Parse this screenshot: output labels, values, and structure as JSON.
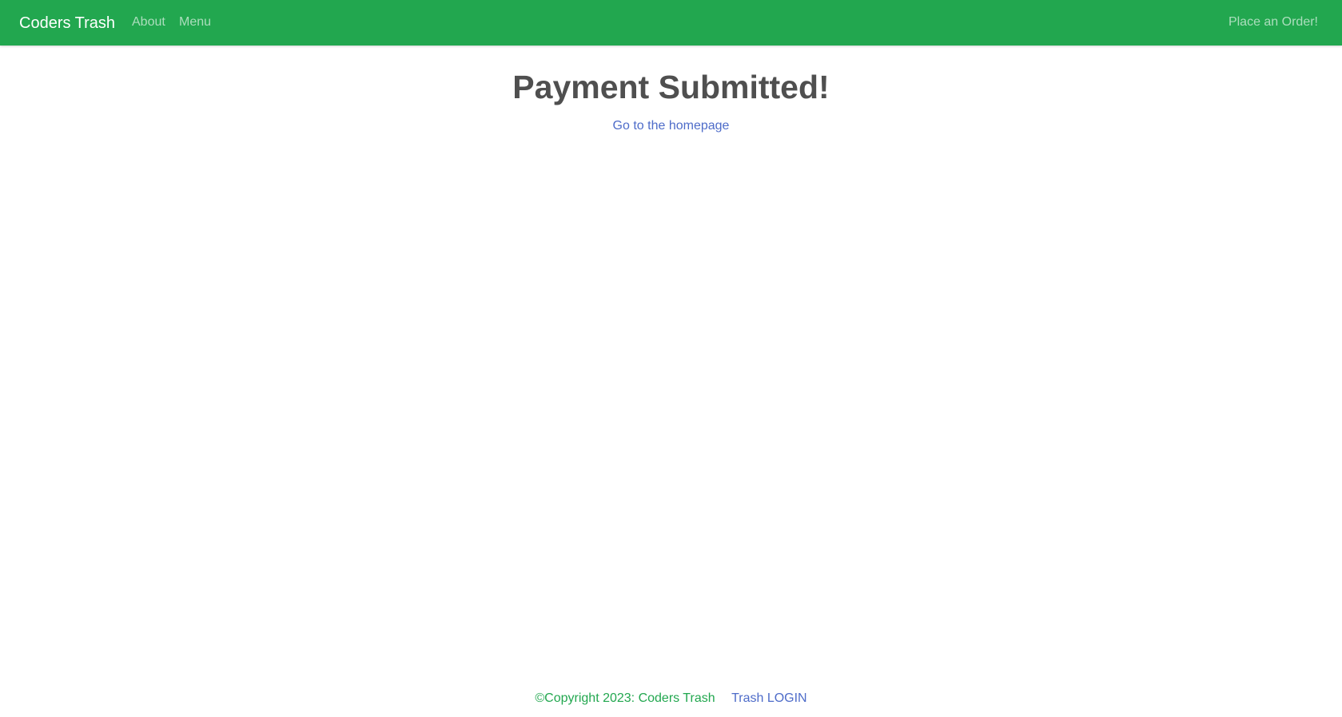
{
  "navbar": {
    "brand": "Coders Trash",
    "links": [
      {
        "label": "About"
      },
      {
        "label": "Menu"
      }
    ],
    "order_label": "Place an Order!",
    "bg_color": "#22a74f"
  },
  "main": {
    "title": "Payment Submitted!",
    "home_link": "Go to the homepage"
  },
  "footer": {
    "copyright": "©Copyright 2023: Coders Trash",
    "login_link": "Trash LOGIN"
  },
  "colors": {
    "accent_green": "#22a74f",
    "link_blue": "#4e6cc9",
    "heading_gray": "#4f4f4f"
  }
}
